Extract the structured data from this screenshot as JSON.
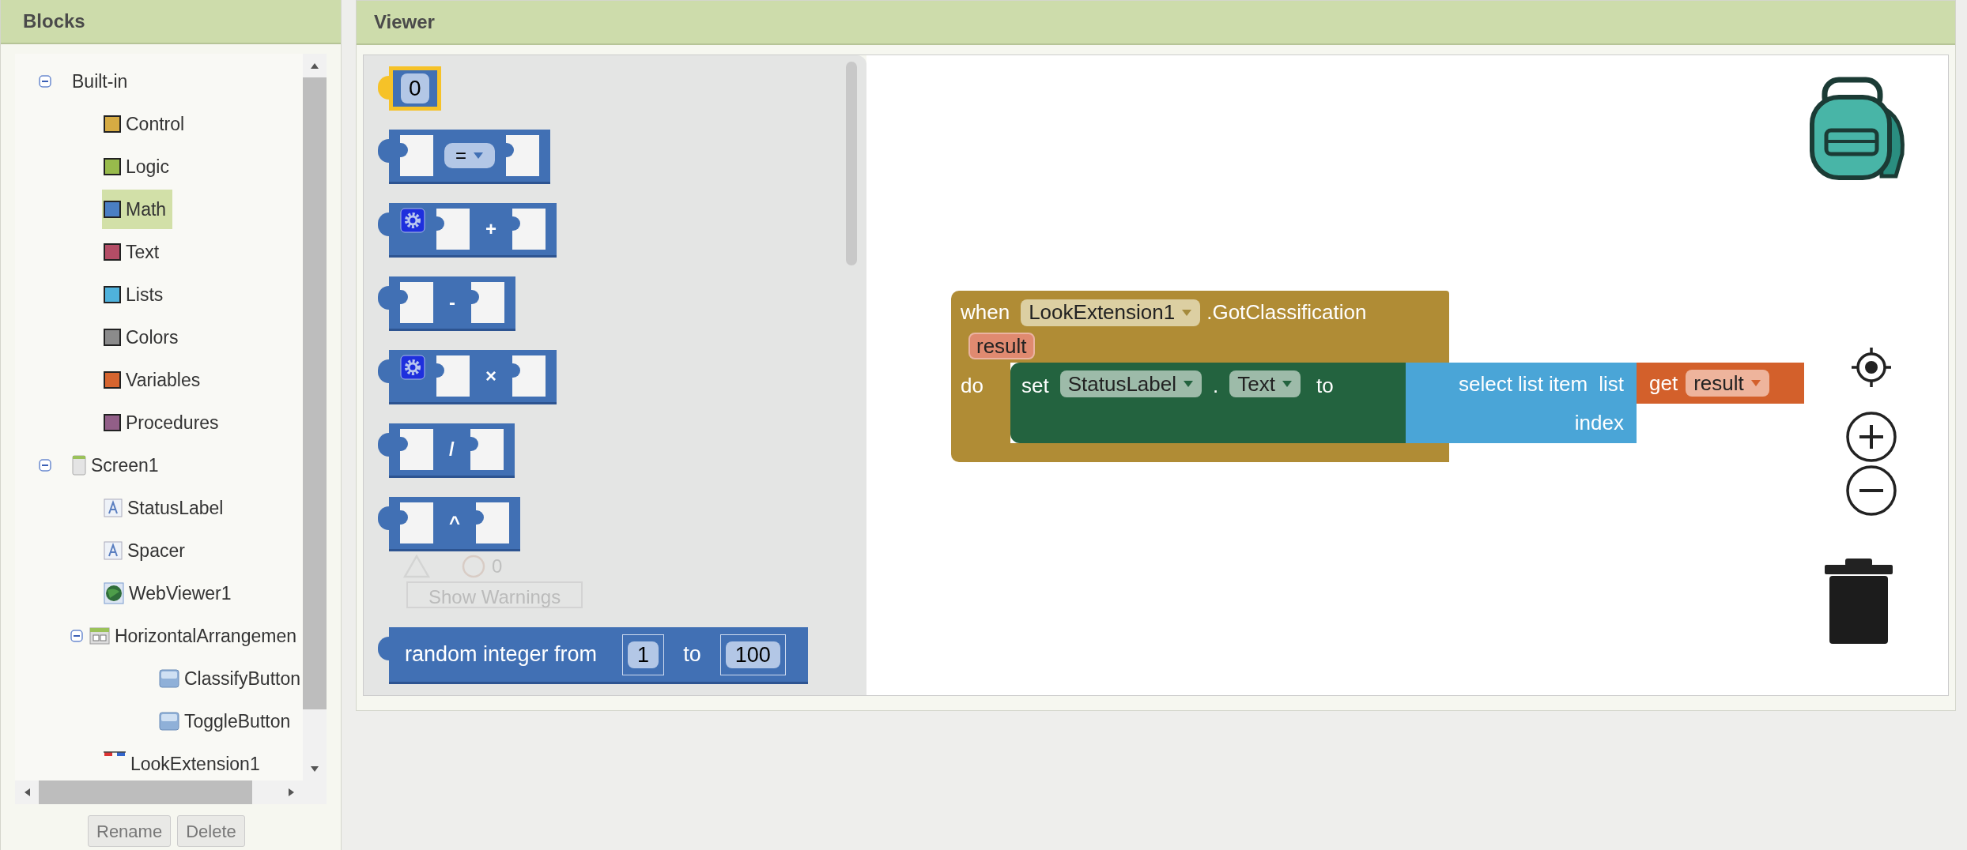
{
  "blocks_panel": {
    "title": "Blocks",
    "tree": [
      {
        "label": "Built-in",
        "kind": "group",
        "expanded": true,
        "selected": false,
        "children": [
          {
            "label": "Control",
            "kind": "category",
            "color": "#d6ab43",
            "selected": false
          },
          {
            "label": "Logic",
            "kind": "category",
            "color": "#98bb4c",
            "selected": false
          },
          {
            "label": "Math",
            "kind": "category",
            "color": "#4a7fc4",
            "selected": true
          },
          {
            "label": "Text",
            "kind": "category",
            "color": "#b44d66",
            "selected": false
          },
          {
            "label": "Lists",
            "kind": "category",
            "color": "#4fb2dc",
            "selected": false
          },
          {
            "label": "Colors",
            "kind": "category",
            "color": "#8b8b8b",
            "selected": false
          },
          {
            "label": "Variables",
            "kind": "category",
            "color": "#d6652f",
            "selected": false
          },
          {
            "label": "Procedures",
            "kind": "category",
            "color": "#925f88",
            "selected": false
          }
        ]
      },
      {
        "label": "Screen1",
        "kind": "screen",
        "expanded": true,
        "selected": false,
        "children": [
          {
            "label": "StatusLabel",
            "kind": "label",
            "selected": false
          },
          {
            "label": "Spacer",
            "kind": "label",
            "selected": false
          },
          {
            "label": "WebViewer1",
            "kind": "webviewer",
            "selected": false
          },
          {
            "label": "HorizontalArrangemen",
            "kind": "arrangement",
            "expanded": true,
            "selected": false,
            "children": [
              {
                "label": "ClassifyButton",
                "kind": "button",
                "selected": false
              },
              {
                "label": "ToggleButton",
                "kind": "button",
                "selected": false
              }
            ]
          },
          {
            "label": "LookExtension1",
            "kind": "extension",
            "selected": false
          }
        ]
      }
    ],
    "buttons": [
      "Rename",
      "Delete"
    ]
  },
  "viewer": {
    "title": "Viewer",
    "flyout": {
      "blocks": [
        {
          "kind": "number",
          "value": "0",
          "selected": true
        },
        {
          "kind": "compare",
          "op": "="
        },
        {
          "kind": "mutator",
          "op": "+"
        },
        {
          "kind": "binary",
          "op": "-"
        },
        {
          "kind": "mutator",
          "op": "×"
        },
        {
          "kind": "binary",
          "op": "/"
        },
        {
          "kind": "binary",
          "op": "^"
        },
        {
          "kind": "random",
          "label": "random integer from",
          "from": "1",
          "to_label": "to",
          "to": "100"
        }
      ],
      "warnings": {
        "count": "0",
        "button": "Show Warnings"
      }
    },
    "workspace": {
      "event": {
        "when": "when",
        "component": "LookExtension1",
        "event_name": ".GotClassification",
        "param": "result",
        "do": "do",
        "statement": {
          "set": "set",
          "component": "StatusLabel",
          "dot": ".",
          "property": "Text",
          "to": "to",
          "value": {
            "label": "select list item",
            "list_label": "list",
            "index_label": "index",
            "list_value": {
              "get": "get",
              "variable": "result"
            }
          }
        }
      }
    }
  }
}
